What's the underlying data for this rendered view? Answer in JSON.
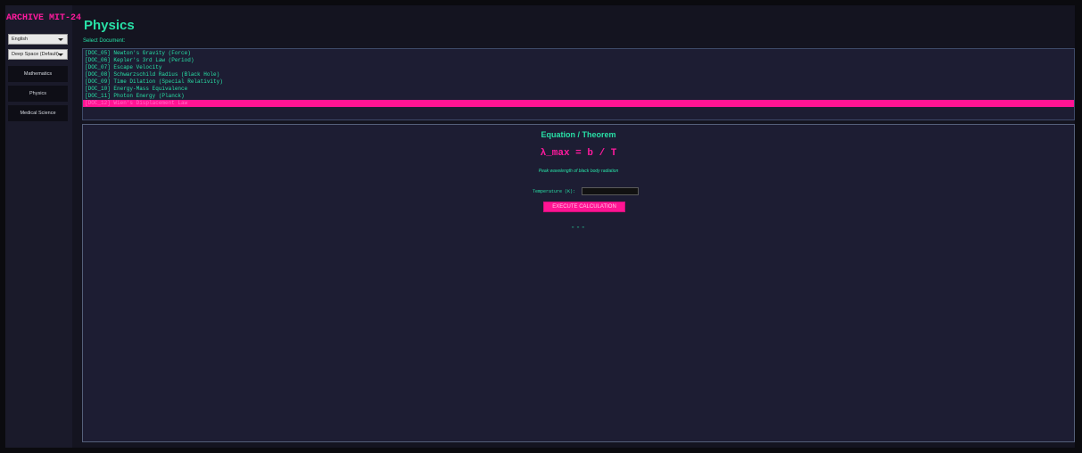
{
  "app": {
    "brand": "ARCHIVE MIT-24"
  },
  "sidebar": {
    "language_select": "English",
    "theme_select": "Deep Space (Default)",
    "nav": [
      {
        "label": "Mathematics"
      },
      {
        "label": "Physics"
      },
      {
        "label": "Medical Science"
      }
    ]
  },
  "header": {
    "title": "Physics"
  },
  "document_picker": {
    "label": "Select Document:",
    "items": [
      {
        "label": "[DOC_05] Newton's Gravity (Force)"
      },
      {
        "label": "[DOC_06] Kepler's 3rd Law (Period)"
      },
      {
        "label": "[DOC_07] Escape Velocity"
      },
      {
        "label": "[DOC_08] Schwarzschild Radius (Black Hole)"
      },
      {
        "label": "[DOC_09] Time Dilation (Special Relativity)"
      },
      {
        "label": "[DOC_10] Energy-Mass Equivalence"
      },
      {
        "label": "[DOC_11] Photon Energy (Planck)"
      },
      {
        "label": "[DOC_12] Wien's Displacement Law",
        "selected": true
      }
    ]
  },
  "panel": {
    "heading": "Equation / Theorem",
    "formula": "λ_max = b / T",
    "description": "Peak wavelength of black body radiation",
    "input_label": "Temperature (K):",
    "input_value": "",
    "button_label": "EXECUTE CALCULATION",
    "result": "---"
  },
  "colors": {
    "accent": "#28e0a6",
    "highlight": "#ff1493",
    "background": "#141420"
  }
}
